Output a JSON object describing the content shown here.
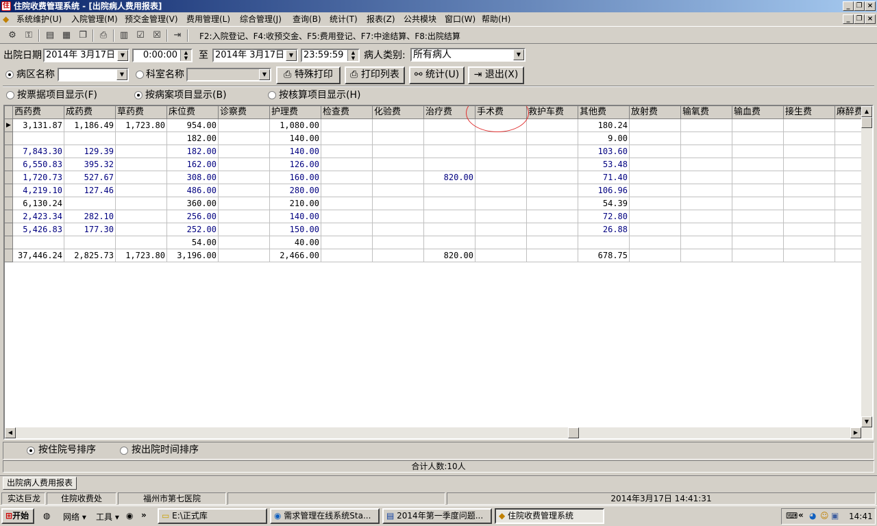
{
  "window": {
    "title": "住院收费管理系统 - [出院病人费用报表]",
    "app_icon": "hospital-icon"
  },
  "menu": [
    "系统维护(U)",
    "入院管理(M)",
    "预交金管理(V)",
    "费用管理(L)",
    "综合管理(J)",
    "查询(B)",
    "统计(T)",
    "报表(Z)",
    "公共模块",
    "窗口(W)",
    "帮助(H)"
  ],
  "toolbar": {
    "hint": "F2:入院登记、F4:收预交金、F5:费用登记、F7:中途结算、F8:出院结算"
  },
  "filters": {
    "discharge_date_label": "出院日期",
    "date_from": "2014年 3月17日",
    "time_from": "0:00:00",
    "to_label": "至",
    "date_to": "2014年 3月17日",
    "time_to": "23:59:59",
    "patient_type_label": "病人类别:",
    "patient_type": "所有病人",
    "ward_label": "病区名称",
    "ward_value": "",
    "dept_label": "科室名称",
    "dept_value": ""
  },
  "buttons": {
    "special_print": "特殊打印",
    "print_list": "打印列表",
    "stats": "统计(U)",
    "exit": "退出(X)"
  },
  "view_mode": {
    "by_receipt": "按票据项目显示(F)",
    "by_case": "按病案项目显示(B)",
    "by_settle": "按核算项目显示(H)",
    "selected": "by_case"
  },
  "table": {
    "columns": [
      "西药费",
      "成药费",
      "草药费",
      "床位费",
      "诊察费",
      "护理费",
      "检查费",
      "化验费",
      "治疗费",
      "手术费",
      "救护车费",
      "其他费",
      "放射费",
      "输氧费",
      "输血费",
      "接生费",
      "麻醉费"
    ],
    "rows": [
      [
        "3,131.87",
        "1,186.49",
        "1,723.80",
        "954.00",
        "",
        "1,080.00",
        "",
        "",
        "",
        "",
        "",
        "180.24",
        "",
        "",
        "",
        "",
        ""
      ],
      [
        "",
        "",
        "",
        "182.00",
        "",
        "140.00",
        "",
        "",
        "",
        "",
        "",
        "9.00",
        "",
        "",
        "",
        "",
        ""
      ],
      [
        "7,843.30",
        "129.39",
        "",
        "182.00",
        "",
        "140.00",
        "",
        "",
        "",
        "",
        "",
        "103.60",
        "",
        "",
        "",
        "",
        ""
      ],
      [
        "6,550.83",
        "395.32",
        "",
        "162.00",
        "",
        "126.00",
        "",
        "",
        "",
        "",
        "",
        "53.48",
        "",
        "",
        "",
        "",
        ""
      ],
      [
        "1,720.73",
        "527.67",
        "",
        "308.00",
        "",
        "160.00",
        "",
        "",
        "820.00",
        "",
        "",
        "71.40",
        "",
        "",
        "",
        "",
        ""
      ],
      [
        "4,219.10",
        "127.46",
        "",
        "486.00",
        "",
        "280.00",
        "",
        "",
        "",
        "",
        "",
        "106.96",
        "",
        "",
        "",
        "",
        ""
      ],
      [
        "6,130.24",
        "",
        "",
        "360.00",
        "",
        "210.00",
        "",
        "",
        "",
        "",
        "",
        "54.39",
        "",
        "",
        "",
        "",
        ""
      ],
      [
        "2,423.34",
        "282.10",
        "",
        "256.00",
        "",
        "140.00",
        "",
        "",
        "",
        "",
        "",
        "72.80",
        "",
        "",
        "",
        "",
        ""
      ],
      [
        "5,426.83",
        "177.30",
        "",
        "252.00",
        "",
        "150.00",
        "",
        "",
        "",
        "",
        "",
        "26.88",
        "",
        "",
        "",
        "",
        ""
      ],
      [
        "",
        "",
        "",
        "54.00",
        "",
        "40.00",
        "",
        "",
        "",
        "",
        "",
        "",
        "",
        "",
        "",
        "",
        ""
      ],
      [
        "37,446.24",
        "2,825.73",
        "1,723.80",
        "3,196.00",
        "",
        "2,466.00",
        "",
        "",
        "820.00",
        "",
        "",
        "678.75",
        "",
        "",
        "",
        "",
        ""
      ]
    ],
    "highlight_column": "手术费",
    "highlight_color": "#e03030",
    "value_color": "#000080"
  },
  "sort": {
    "by_admission_no": "按住院号排序",
    "by_discharge_time": "按出院时间排序",
    "selected": "by_admission_no"
  },
  "summary": "合计人数:10人",
  "mdi_tab": "出院病人费用报表",
  "status": {
    "company": "实达巨龙",
    "office": "住院收费处",
    "hospital": "福州市第七医院",
    "datetime": "2014年3月17日 14:41:31"
  },
  "taskbar": {
    "start": "开始",
    "network": "网络",
    "tools": "工具",
    "tasks": [
      "E:\\正式库",
      "需求管理在线系统Sta...",
      "2014年第一季度问题...",
      "住院收费管理系统"
    ],
    "clock": "14:41"
  }
}
